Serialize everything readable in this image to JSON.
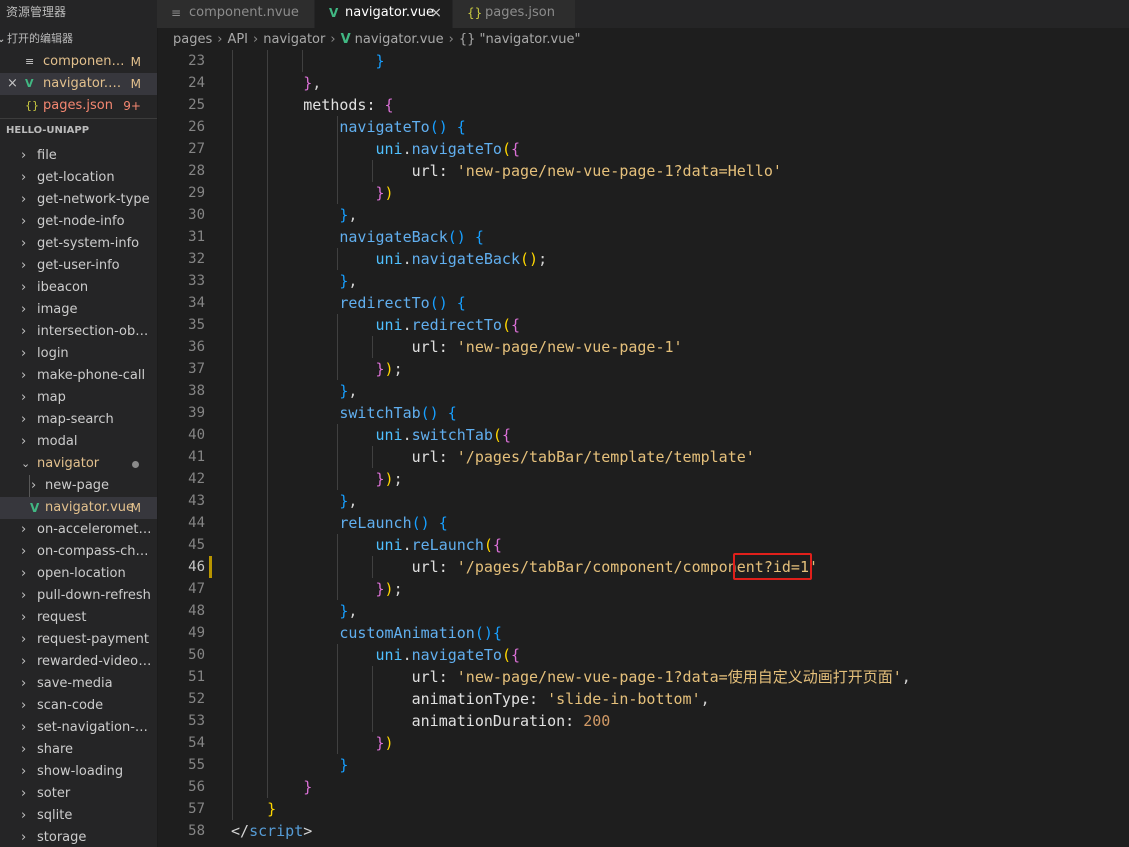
{
  "sidebar": {
    "title": "资源管理器",
    "open_editors_label": "打开的编辑器",
    "open_editors": [
      {
        "icon": "≡",
        "name": "component.nvue",
        "badge": "M"
      },
      {
        "icon": "V",
        "name": "navigator.vue",
        "badge": "M"
      },
      {
        "icon": "{}",
        "name": "pages.json",
        "badge": "9+"
      }
    ],
    "project_label": "HELLO-UNIAPP",
    "tree": [
      "file",
      "get-location",
      "get-network-type",
      "get-node-info",
      "get-system-info",
      "get-user-info",
      "ibeacon",
      "image",
      "intersection-observer",
      "login",
      "make-phone-call",
      "map",
      "map-search",
      "modal",
      "navigator",
      "new-page",
      "navigator.vue",
      "on-accelerometer-change",
      "on-compass-change",
      "open-location",
      "pull-down-refresh",
      "request",
      "request-payment",
      "rewarded-video-ad",
      "save-media",
      "scan-code",
      "set-navigation-bar-title",
      "share",
      "show-loading",
      "soter",
      "sqlite",
      "storage"
    ],
    "navigator_vue_badge": "M"
  },
  "tabs": [
    {
      "icon": "≡",
      "label": "component.nvue"
    },
    {
      "icon": "V",
      "label": "navigator.vue",
      "close": "×"
    },
    {
      "icon": "{}",
      "label": "pages.json"
    }
  ],
  "breadcrumb": {
    "parts": [
      "pages",
      "API",
      "navigator"
    ],
    "file": "navigator.vue",
    "symbol": "{} \"navigator.vue\""
  },
  "editor": {
    "line_numbers": [
      "23",
      "24",
      "25",
      "26",
      "27",
      "28",
      "29",
      "30",
      "31",
      "32",
      "33",
      "34",
      "35",
      "36",
      "37",
      "38",
      "39",
      "40",
      "41",
      "42",
      "43",
      "44",
      "45",
      "46",
      "47",
      "48",
      "49",
      "50",
      "51",
      "52",
      "53",
      "54",
      "55",
      "56",
      "57",
      "58"
    ],
    "strings": {
      "s28": "'new-page/new-vue-page-1?data=Hello'",
      "s35": "'new-page/new-vue-page-1'",
      "s41": "'/pages/tabBar/template/template'",
      "s46": "'/pages/tabBar/component/component?id=1'",
      "s51": "'new-page/new-vue-page-1?data=使用自定义动画打开页面'",
      "s52": "'slide-in-bottom'",
      "n53": "200"
    }
  },
  "colors": {
    "background": "#1e1e1e",
    "sidebar": "#252526",
    "highlight_box": "#e0201b",
    "vue_icon": "#41b883",
    "json_icon": "#cbcb41",
    "modified": "#e2c08d"
  }
}
